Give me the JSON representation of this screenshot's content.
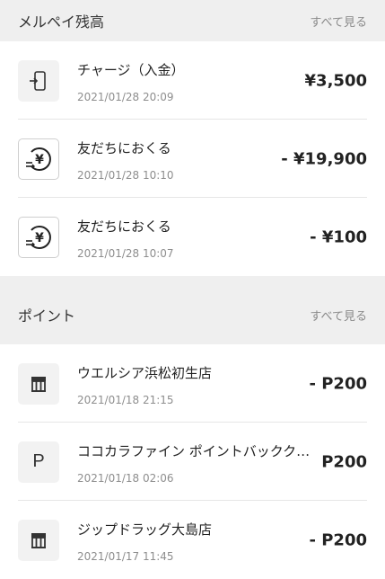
{
  "balance_section": {
    "title": "メルペイ残高",
    "see_all": "すべて見る",
    "items": [
      {
        "title": "チャージ（入金）",
        "date": "2021/01/28 20:09",
        "amount": "¥3,500",
        "icon": "phone-charge-icon"
      },
      {
        "title": "友だちにおくる",
        "date": "2021/01/28 10:10",
        "amount": "- ¥19,900",
        "icon": "yen-send-icon"
      },
      {
        "title": "友だちにおくる",
        "date": "2021/01/28 10:07",
        "amount": "- ¥100",
        "icon": "yen-send-icon"
      }
    ]
  },
  "point_section": {
    "title": "ポイント",
    "see_all": "すべて見る",
    "items": [
      {
        "title": "ウエルシア浜松初生店",
        "date": "2021/01/18 21:15",
        "amount": "- P200",
        "icon": "store-icon"
      },
      {
        "title": "ココカラファイン ポイントバックク…",
        "date": "2021/01/18 02:06",
        "amount": "P200",
        "icon": "point-p-icon",
        "icon_text": "P"
      },
      {
        "title": "ジップドラッグ大島店",
        "date": "2021/01/17 11:45",
        "amount": "- P200",
        "icon": "store-icon"
      }
    ]
  }
}
